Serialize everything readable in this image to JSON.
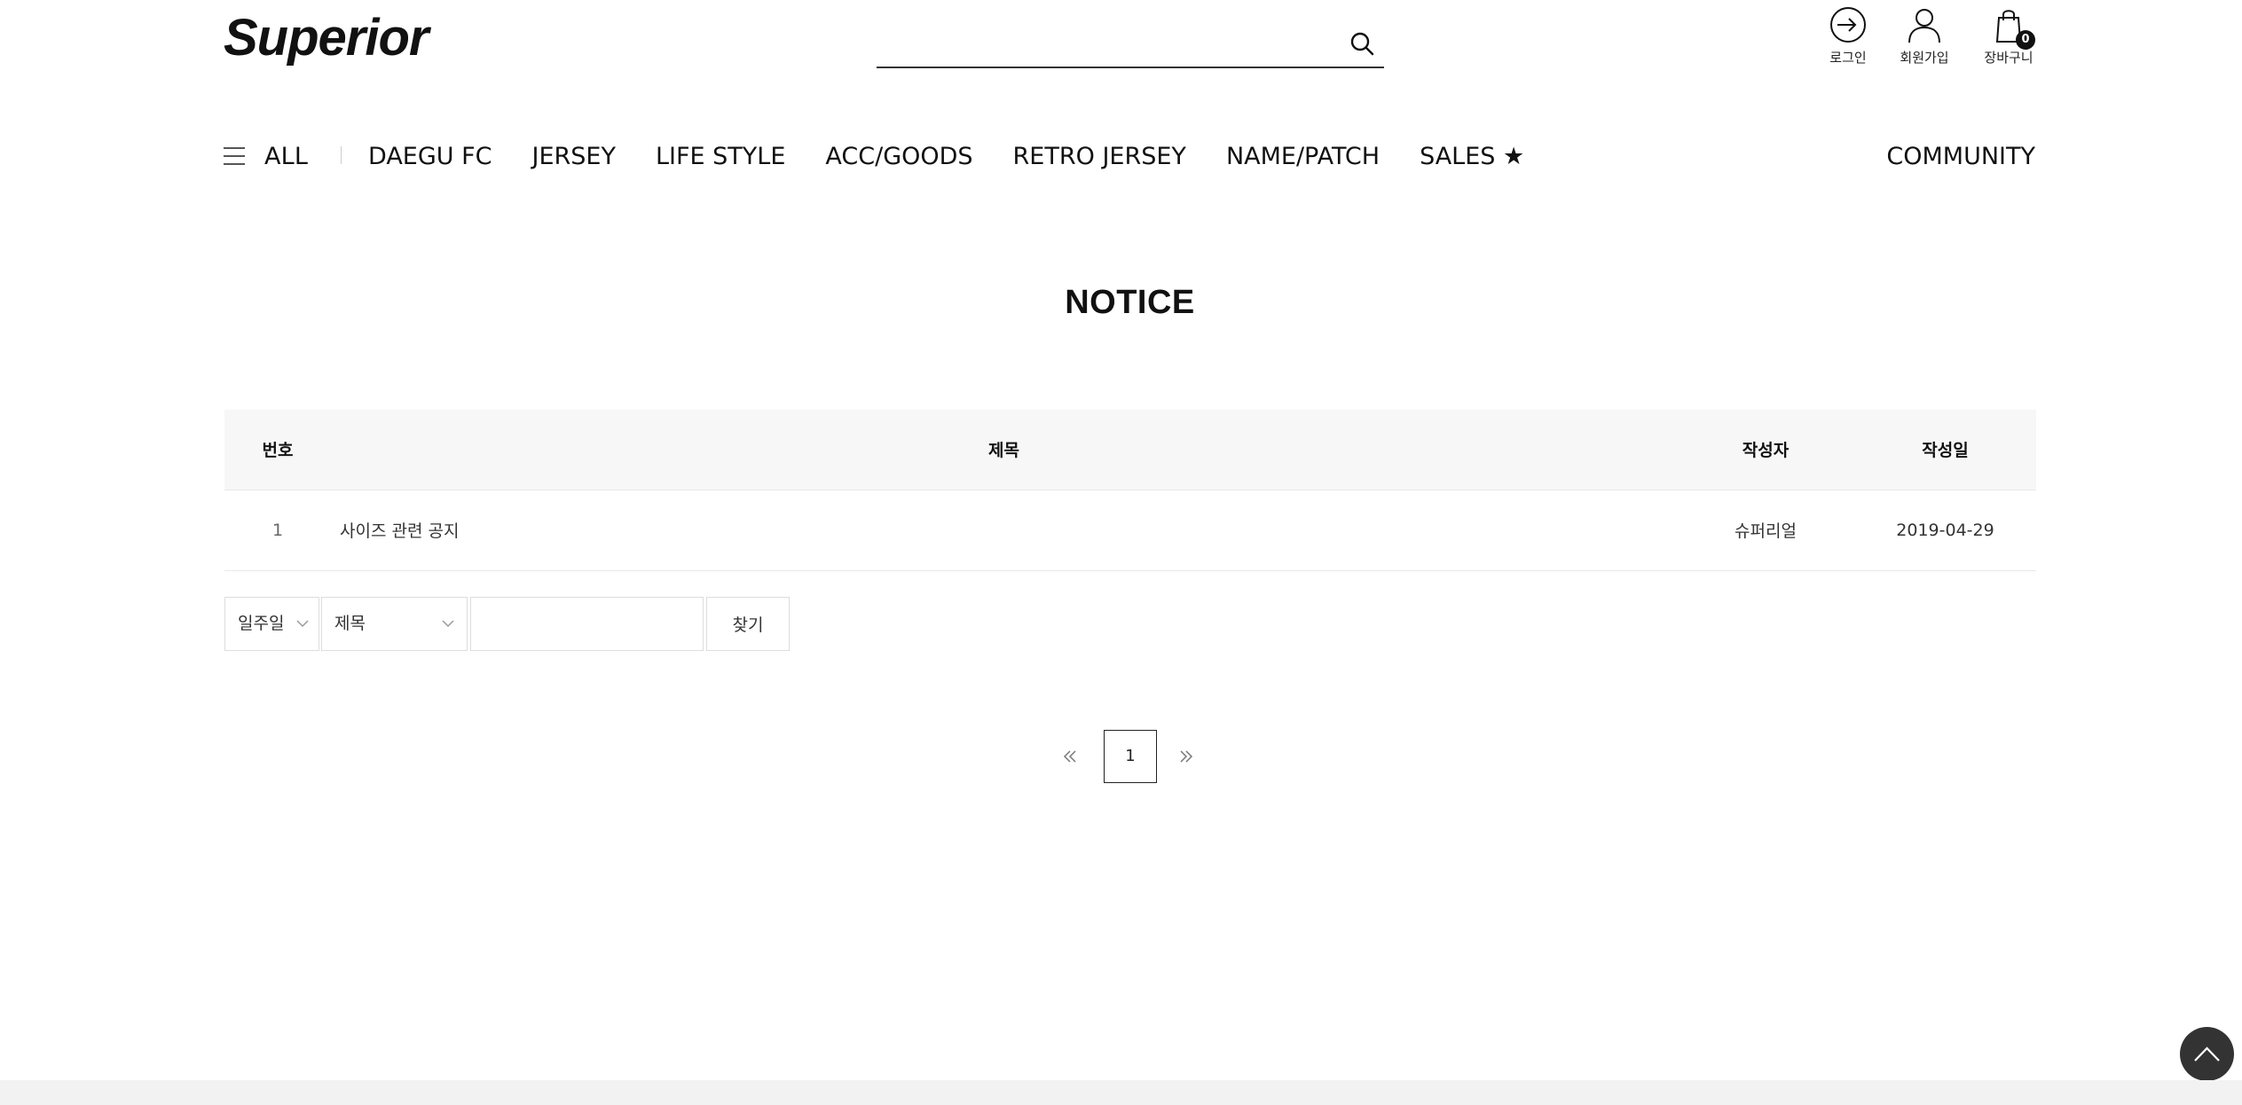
{
  "brand": {
    "logo_text": "Superior"
  },
  "search": {
    "placeholder": "",
    "value": "",
    "icon": "search-icon"
  },
  "utility_nav": {
    "login": {
      "label": "로그인",
      "icon": "login-arrow-icon"
    },
    "join": {
      "label": "회원가입",
      "icon": "user-icon"
    },
    "cart": {
      "label": "장바구니",
      "icon": "shopping-bag-icon",
      "count": "0"
    }
  },
  "gnb": {
    "all_label": "ALL",
    "items": [
      {
        "label": "DAEGU FC"
      },
      {
        "label": "JERSEY"
      },
      {
        "label": "LIFE STYLE"
      },
      {
        "label": "ACC/GOODS"
      },
      {
        "label": "RETRO JERSEY"
      },
      {
        "label": "NAME/PATCH"
      },
      {
        "label": "SALES ★"
      }
    ],
    "community_label": "COMMUNITY"
  },
  "page": {
    "title": "NOTICE"
  },
  "board": {
    "columns": [
      "번호",
      "제목",
      "작성자",
      "작성일"
    ],
    "rows": [
      {
        "num": "1",
        "subject": "사이즈 관련 공지",
        "writer": "슈퍼리얼",
        "date": "2019-04-29"
      }
    ]
  },
  "search_form": {
    "period_value": "일주일",
    "field_value": "제목",
    "keyword_value": "",
    "find_label": "찾기"
  },
  "pagination": {
    "pages": [
      "1"
    ],
    "current": "1"
  },
  "colors": {
    "text": "#111111",
    "header_bg": "#f7f7f7",
    "border": "#dddddd",
    "top_button": "#333333"
  }
}
